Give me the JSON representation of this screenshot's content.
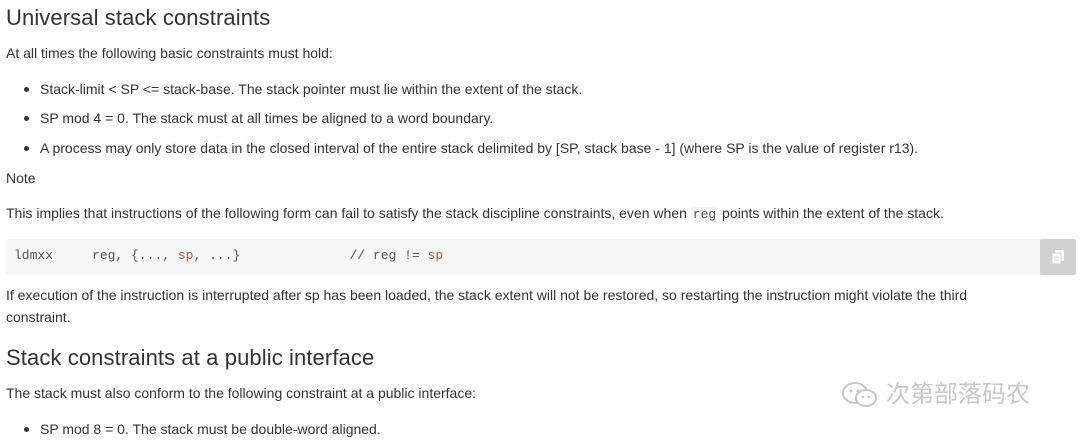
{
  "section1": {
    "title": "Universal stack constraints",
    "intro": "At all times the following basic constraints must hold:",
    "bullets": [
      "Stack-limit < SP <= stack-base. The stack pointer must lie within the extent of the stack.",
      "SP mod 4 = 0. The stack must at all times be aligned to a word boundary.",
      "A process may only store data in the closed interval of the entire stack delimited by [SP, stack base - 1] (where SP is the value of register r13)."
    ],
    "note_label": "Note",
    "note_text_before": "This implies that instructions of the following form can fail to satisfy the stack discipline constraints, even when ",
    "note_code": "reg",
    "note_text_after": " points within the extent of the stack.",
    "code": {
      "mnemonic": "ldmxx",
      "operands_before": "reg, {..., ",
      "sp1": "sp",
      "operands_after": ", ...}",
      "comment_before": "// reg != ",
      "sp2": "sp"
    },
    "after_code_line1": "If execution of the instruction is interrupted after sp has been loaded, the stack extent will not be restored, so restarting the instruction might violate the third",
    "after_code_line2": "constraint."
  },
  "section2": {
    "title": "Stack constraints at a public interface",
    "intro": "The stack must also conform to the following constraint at a public interface:",
    "bullets": [
      "SP mod 8 = 0. The stack must be double-word aligned."
    ]
  },
  "watermark": {
    "text": "次第部落码农",
    "icon": "wechat-icon"
  },
  "copy_button": {
    "icon": "copy-icon"
  }
}
